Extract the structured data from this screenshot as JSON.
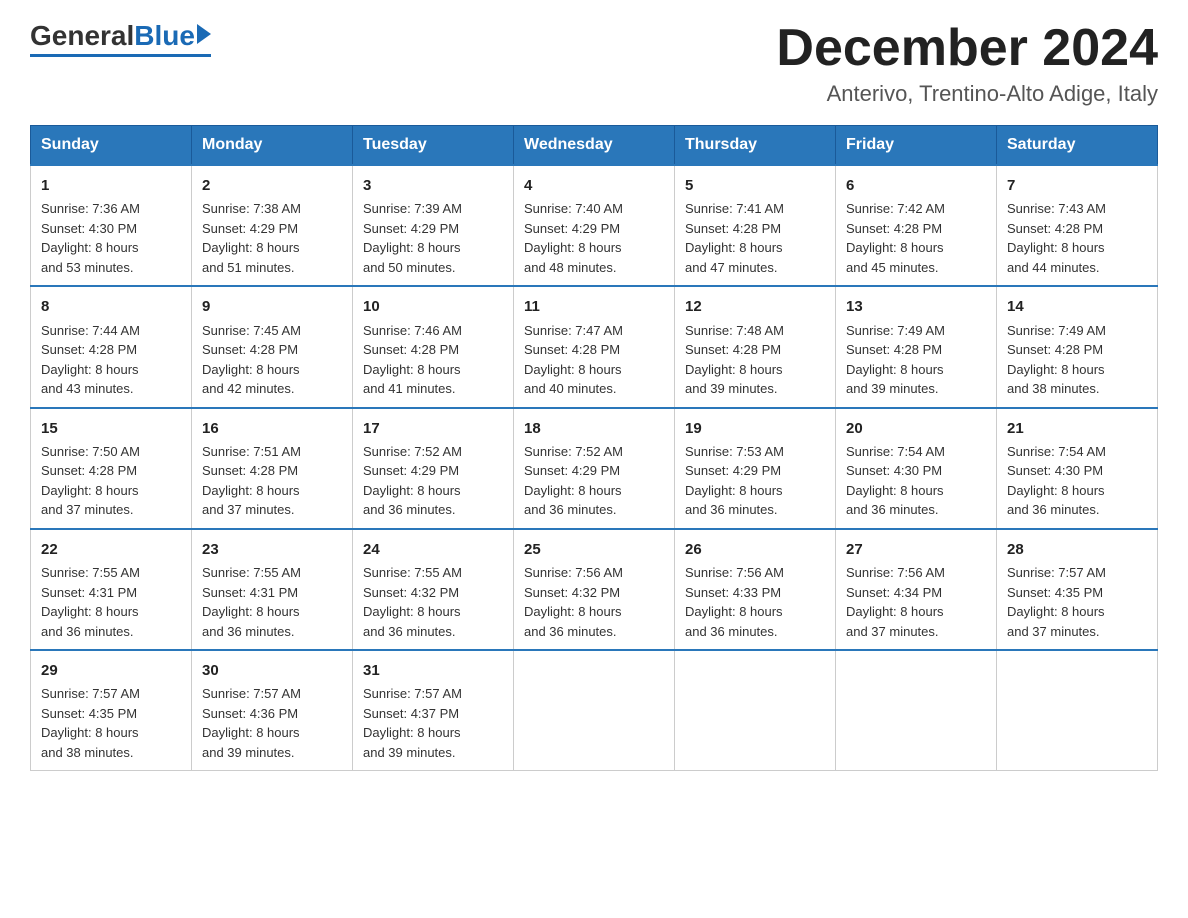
{
  "header": {
    "logo_general": "General",
    "logo_blue": "Blue",
    "month_title": "December 2024",
    "location": "Anterivo, Trentino-Alto Adige, Italy"
  },
  "days_of_week": [
    "Sunday",
    "Monday",
    "Tuesday",
    "Wednesday",
    "Thursday",
    "Friday",
    "Saturday"
  ],
  "weeks": [
    [
      {
        "day": "1",
        "sunrise": "7:36 AM",
        "sunset": "4:30 PM",
        "daylight": "8 hours and 53 minutes."
      },
      {
        "day": "2",
        "sunrise": "7:38 AM",
        "sunset": "4:29 PM",
        "daylight": "8 hours and 51 minutes."
      },
      {
        "day": "3",
        "sunrise": "7:39 AM",
        "sunset": "4:29 PM",
        "daylight": "8 hours and 50 minutes."
      },
      {
        "day": "4",
        "sunrise": "7:40 AM",
        "sunset": "4:29 PM",
        "daylight": "8 hours and 48 minutes."
      },
      {
        "day": "5",
        "sunrise": "7:41 AM",
        "sunset": "4:28 PM",
        "daylight": "8 hours and 47 minutes."
      },
      {
        "day": "6",
        "sunrise": "7:42 AM",
        "sunset": "4:28 PM",
        "daylight": "8 hours and 45 minutes."
      },
      {
        "day": "7",
        "sunrise": "7:43 AM",
        "sunset": "4:28 PM",
        "daylight": "8 hours and 44 minutes."
      }
    ],
    [
      {
        "day": "8",
        "sunrise": "7:44 AM",
        "sunset": "4:28 PM",
        "daylight": "8 hours and 43 minutes."
      },
      {
        "day": "9",
        "sunrise": "7:45 AM",
        "sunset": "4:28 PM",
        "daylight": "8 hours and 42 minutes."
      },
      {
        "day": "10",
        "sunrise": "7:46 AM",
        "sunset": "4:28 PM",
        "daylight": "8 hours and 41 minutes."
      },
      {
        "day": "11",
        "sunrise": "7:47 AM",
        "sunset": "4:28 PM",
        "daylight": "8 hours and 40 minutes."
      },
      {
        "day": "12",
        "sunrise": "7:48 AM",
        "sunset": "4:28 PM",
        "daylight": "8 hours and 39 minutes."
      },
      {
        "day": "13",
        "sunrise": "7:49 AM",
        "sunset": "4:28 PM",
        "daylight": "8 hours and 39 minutes."
      },
      {
        "day": "14",
        "sunrise": "7:49 AM",
        "sunset": "4:28 PM",
        "daylight": "8 hours and 38 minutes."
      }
    ],
    [
      {
        "day": "15",
        "sunrise": "7:50 AM",
        "sunset": "4:28 PM",
        "daylight": "8 hours and 37 minutes."
      },
      {
        "day": "16",
        "sunrise": "7:51 AM",
        "sunset": "4:28 PM",
        "daylight": "8 hours and 37 minutes."
      },
      {
        "day": "17",
        "sunrise": "7:52 AM",
        "sunset": "4:29 PM",
        "daylight": "8 hours and 36 minutes."
      },
      {
        "day": "18",
        "sunrise": "7:52 AM",
        "sunset": "4:29 PM",
        "daylight": "8 hours and 36 minutes."
      },
      {
        "day": "19",
        "sunrise": "7:53 AM",
        "sunset": "4:29 PM",
        "daylight": "8 hours and 36 minutes."
      },
      {
        "day": "20",
        "sunrise": "7:54 AM",
        "sunset": "4:30 PM",
        "daylight": "8 hours and 36 minutes."
      },
      {
        "day": "21",
        "sunrise": "7:54 AM",
        "sunset": "4:30 PM",
        "daylight": "8 hours and 36 minutes."
      }
    ],
    [
      {
        "day": "22",
        "sunrise": "7:55 AM",
        "sunset": "4:31 PM",
        "daylight": "8 hours and 36 minutes."
      },
      {
        "day": "23",
        "sunrise": "7:55 AM",
        "sunset": "4:31 PM",
        "daylight": "8 hours and 36 minutes."
      },
      {
        "day": "24",
        "sunrise": "7:55 AM",
        "sunset": "4:32 PM",
        "daylight": "8 hours and 36 minutes."
      },
      {
        "day": "25",
        "sunrise": "7:56 AM",
        "sunset": "4:32 PM",
        "daylight": "8 hours and 36 minutes."
      },
      {
        "day": "26",
        "sunrise": "7:56 AM",
        "sunset": "4:33 PM",
        "daylight": "8 hours and 36 minutes."
      },
      {
        "day": "27",
        "sunrise": "7:56 AM",
        "sunset": "4:34 PM",
        "daylight": "8 hours and 37 minutes."
      },
      {
        "day": "28",
        "sunrise": "7:57 AM",
        "sunset": "4:35 PM",
        "daylight": "8 hours and 37 minutes."
      }
    ],
    [
      {
        "day": "29",
        "sunrise": "7:57 AM",
        "sunset": "4:35 PM",
        "daylight": "8 hours and 38 minutes."
      },
      {
        "day": "30",
        "sunrise": "7:57 AM",
        "sunset": "4:36 PM",
        "daylight": "8 hours and 39 minutes."
      },
      {
        "day": "31",
        "sunrise": "7:57 AM",
        "sunset": "4:37 PM",
        "daylight": "8 hours and 39 minutes."
      },
      null,
      null,
      null,
      null
    ]
  ],
  "labels": {
    "sunrise": "Sunrise:",
    "sunset": "Sunset:",
    "daylight": "Daylight:"
  }
}
